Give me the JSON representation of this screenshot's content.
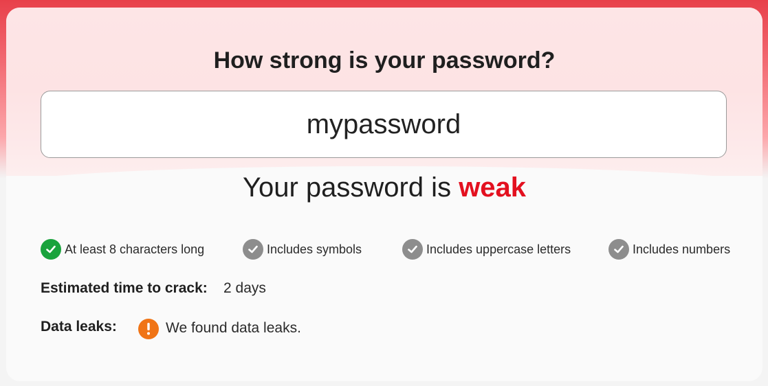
{
  "title": "How strong is your password?",
  "password_input": {
    "value": "mypassword"
  },
  "verdict": {
    "prefix": "Your password is",
    "strength": "weak",
    "strength_color": "#e3101f"
  },
  "criteria": [
    {
      "label": "At least 8 characters long",
      "met": true,
      "icon": "check-circle-icon"
    },
    {
      "label": "Includes symbols",
      "met": false,
      "icon": "check-circle-icon"
    },
    {
      "label": "Includes uppercase letters",
      "met": false,
      "icon": "check-circle-icon"
    },
    {
      "label": "Includes numbers",
      "met": false,
      "icon": "check-circle-icon"
    }
  ],
  "crack_time": {
    "label": "Estimated time to crack:",
    "value": "2 days"
  },
  "data_leaks": {
    "label": "Data leaks:",
    "value": "We found data leaks.",
    "icon": "warning-icon"
  },
  "colors": {
    "accent_red": "#e8404a",
    "met_green": "#1aa33d",
    "unmet_gray": "#8d8d8d",
    "warning_orange": "#f07416"
  }
}
